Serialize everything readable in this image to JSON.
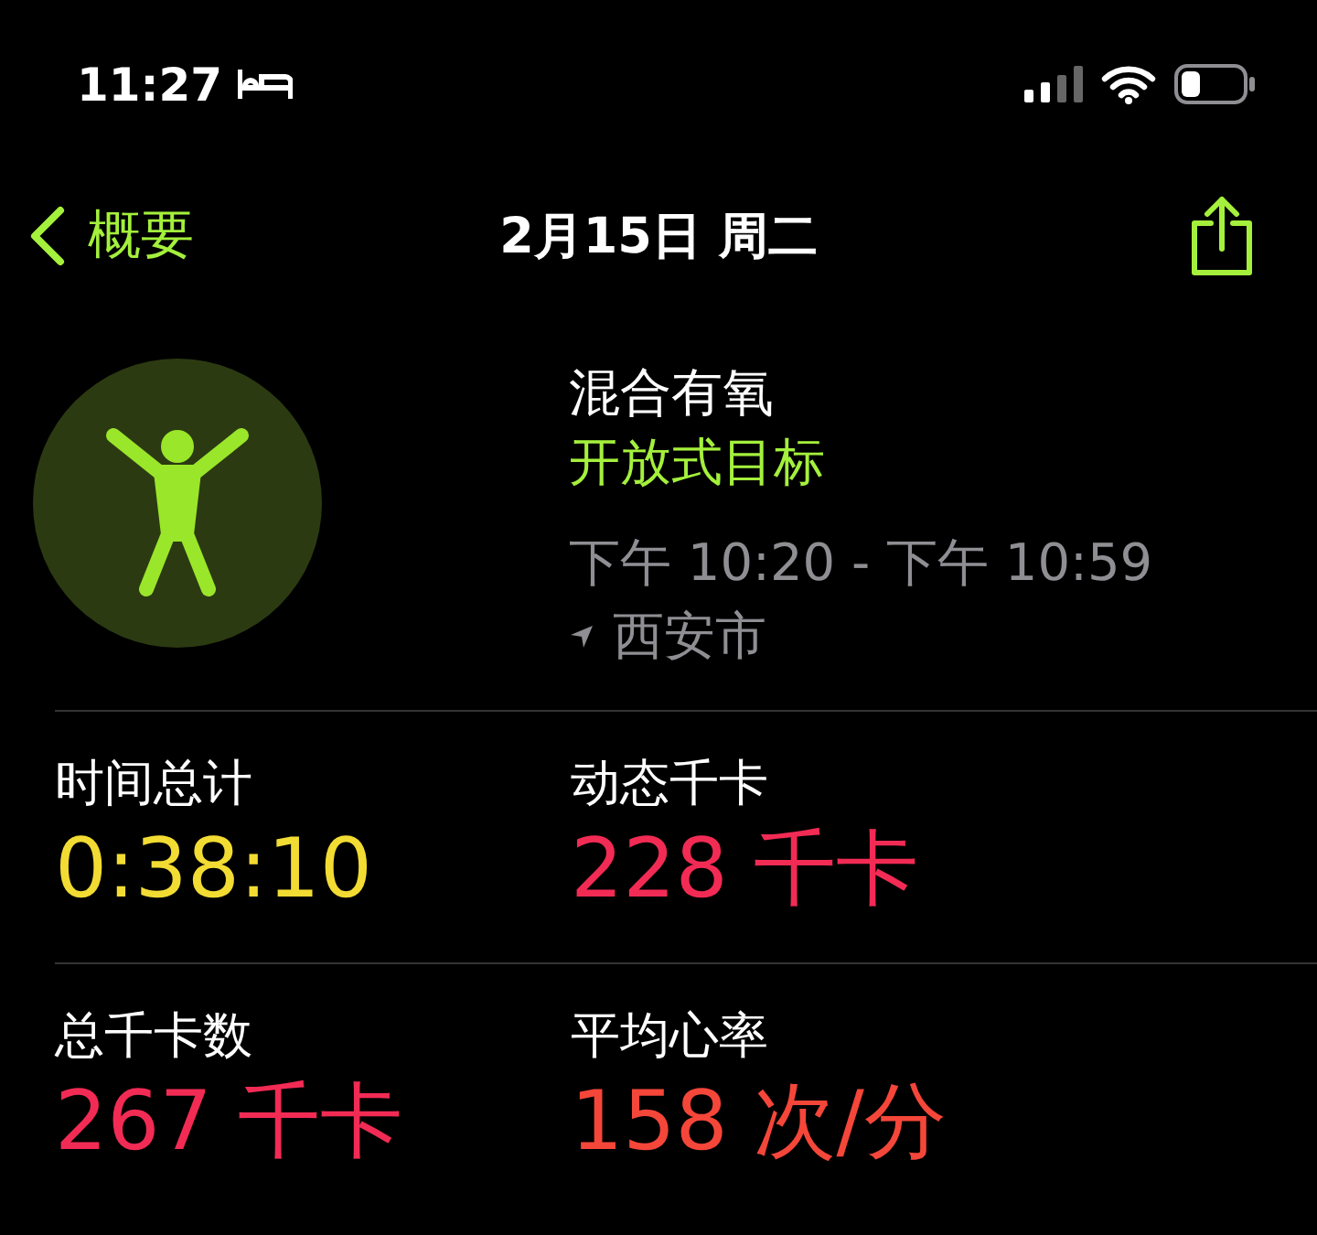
{
  "status_bar": {
    "time": "11:27"
  },
  "nav": {
    "back": "概要",
    "title": "2月15日 周二"
  },
  "workout": {
    "name": "混合有氧",
    "goal": "开放式目标",
    "time_range": "下午 10:20 - 下午 10:59",
    "location": "西安市"
  },
  "metrics": [
    {
      "label": "时间总计",
      "value": "0:38:10",
      "color": "#f2dc33"
    },
    {
      "label": "动态千卡",
      "value": "228 千卡",
      "color": "#f22b55"
    },
    {
      "label": "总千卡数",
      "value": "267 千卡",
      "color": "#f22b55"
    },
    {
      "label": "平均心率",
      "value": "158 次/分",
      "color": "#f5463a"
    }
  ]
}
